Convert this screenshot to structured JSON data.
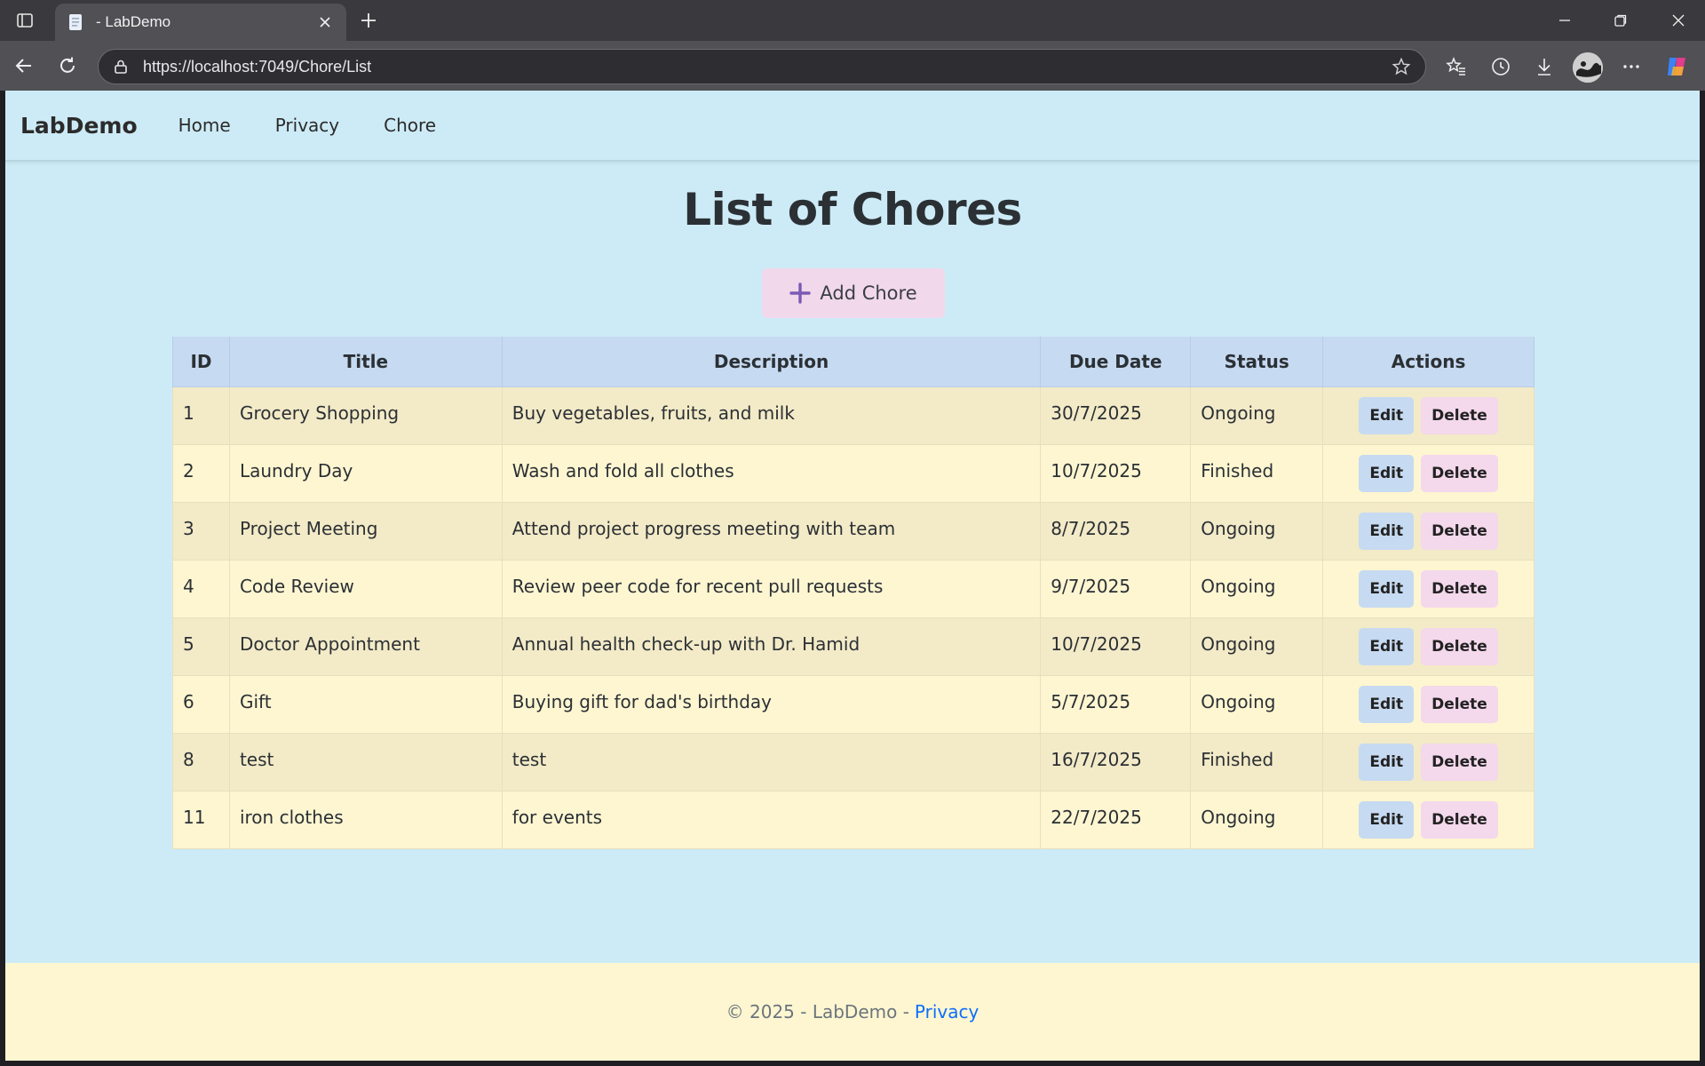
{
  "browser": {
    "tab_title": "- LabDemo",
    "url": "https://localhost:7049/Chore/List"
  },
  "site": {
    "brand": "LabDemo",
    "nav": [
      "Home",
      "Privacy",
      "Chore"
    ]
  },
  "page": {
    "heading": "List of Chores",
    "add_button": "Add Chore"
  },
  "table": {
    "columns": [
      "ID",
      "Title",
      "Description",
      "Due Date",
      "Status",
      "Actions"
    ],
    "edit_label": "Edit",
    "delete_label": "Delete",
    "rows": [
      {
        "id": "1",
        "title": "Grocery Shopping",
        "description": "Buy vegetables, fruits, and milk",
        "due": "30/7/2025",
        "status": "Ongoing"
      },
      {
        "id": "2",
        "title": "Laundry Day",
        "description": "Wash and fold all clothes",
        "due": "10/7/2025",
        "status": "Finished"
      },
      {
        "id": "3",
        "title": "Project Meeting",
        "description": "Attend project progress meeting with team",
        "due": "8/7/2025",
        "status": "Ongoing"
      },
      {
        "id": "4",
        "title": "Code Review",
        "description": "Review peer code for recent pull requests",
        "due": "9/7/2025",
        "status": "Ongoing"
      },
      {
        "id": "5",
        "title": "Doctor Appointment",
        "description": "Annual health check-up with Dr. Hamid",
        "due": "10/7/2025",
        "status": "Ongoing"
      },
      {
        "id": "6",
        "title": "Gift",
        "description": "Buying gift for dad's birthday",
        "due": "5/7/2025",
        "status": "Ongoing"
      },
      {
        "id": "8",
        "title": "test",
        "description": "test",
        "due": "16/7/2025",
        "status": "Finished"
      },
      {
        "id": "11",
        "title": "iron clothes",
        "description": "for events",
        "due": "22/7/2025",
        "status": "Ongoing"
      }
    ]
  },
  "footer": {
    "text": "© 2025 - LabDemo -",
    "link": "Privacy"
  },
  "colors": {
    "page_bg": "#cdebf6",
    "header_bg": "#c6daf1",
    "row_odd": "#f3eac7",
    "row_even": "#fef6d1",
    "add_button_bg": "#f1d8ea",
    "footer_link": "#0d6efd"
  }
}
